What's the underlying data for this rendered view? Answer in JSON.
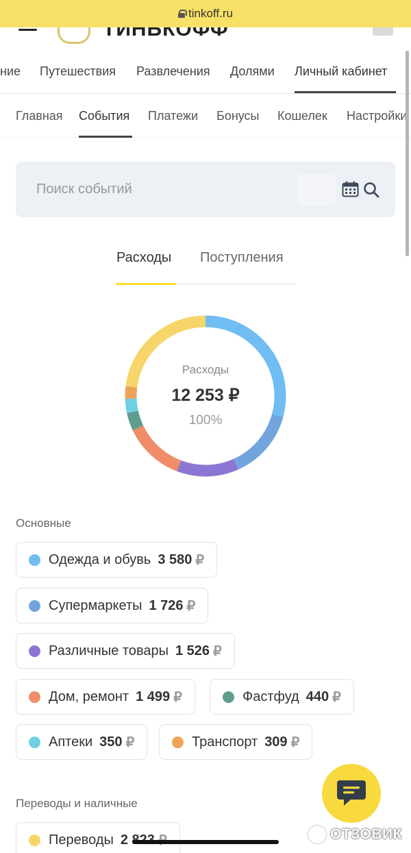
{
  "browser": {
    "url": "tinkoff.ru"
  },
  "header": {
    "logo_text": "ТИНЬКОФФ"
  },
  "top_nav": {
    "items": [
      {
        "label": "ние"
      },
      {
        "label": "Путешествия"
      },
      {
        "label": "Развлечения"
      },
      {
        "label": "Долями"
      },
      {
        "label": "Личный кабинет",
        "active": true
      }
    ]
  },
  "sub_nav": {
    "items": [
      {
        "label": "Главная"
      },
      {
        "label": "События",
        "active": true
      },
      {
        "label": "Платежи"
      },
      {
        "label": "Бонусы"
      },
      {
        "label": "Кошелек"
      },
      {
        "label": "Настройки"
      }
    ]
  },
  "search": {
    "placeholder": "Поиск событий",
    "value": ""
  },
  "tabs": [
    {
      "label": "Расходы",
      "active": true
    },
    {
      "label": "Поступления"
    }
  ],
  "donut": {
    "label": "Расходы",
    "total": "12 253 ₽",
    "percent": "100%"
  },
  "chart_data": {
    "type": "pie",
    "total": 12253,
    "slices": [
      {
        "name": "Одежда и обувь",
        "value": 3580,
        "color": "#6fbdf3"
      },
      {
        "name": "Супермаркеты",
        "value": 1726,
        "color": "#72a4de"
      },
      {
        "name": "Различные товары",
        "value": 1526,
        "color": "#8b77d3"
      },
      {
        "name": "Дом, ремонт",
        "value": 1499,
        "color": "#ee8d68"
      },
      {
        "name": "Фастфуд",
        "value": 440,
        "color": "#5f9d8e"
      },
      {
        "name": "Аптеки",
        "value": 350,
        "color": "#6fd0e3"
      },
      {
        "name": "Транспорт",
        "value": 309,
        "color": "#eda35a"
      },
      {
        "name": "Переводы",
        "value": 2823,
        "color": "#f8d56a"
      }
    ]
  },
  "sections": {
    "main_title": "Основные",
    "transfers_title": "Переводы и наличные"
  },
  "categories": [
    {
      "name": "Одежда и обувь",
      "amount": "3 580",
      "currency": "₽",
      "color": "#6fbdf3"
    },
    {
      "name": "Супермаркеты",
      "amount": "1 726",
      "currency": "₽",
      "color": "#72a4de"
    },
    {
      "name": "Различные товары",
      "amount": "1 526",
      "currency": "₽",
      "color": "#8b77d3"
    },
    {
      "name": "Дом, ремонт",
      "amount": "1 499",
      "currency": "₽",
      "color": "#ee8d68"
    },
    {
      "name": "Фастфуд",
      "amount": "440",
      "currency": "₽",
      "color": "#5f9d8e"
    },
    {
      "name": "Аптеки",
      "amount": "350",
      "currency": "₽",
      "color": "#6fd0e3"
    },
    {
      "name": "Транспорт",
      "amount": "309",
      "currency": "₽",
      "color": "#eda35a"
    }
  ],
  "transfers": [
    {
      "name": "Переводы",
      "amount": "2 823",
      "currency": "₽",
      "color": "#f8d56a"
    }
  ],
  "watermark": "ОТЗОВИК"
}
